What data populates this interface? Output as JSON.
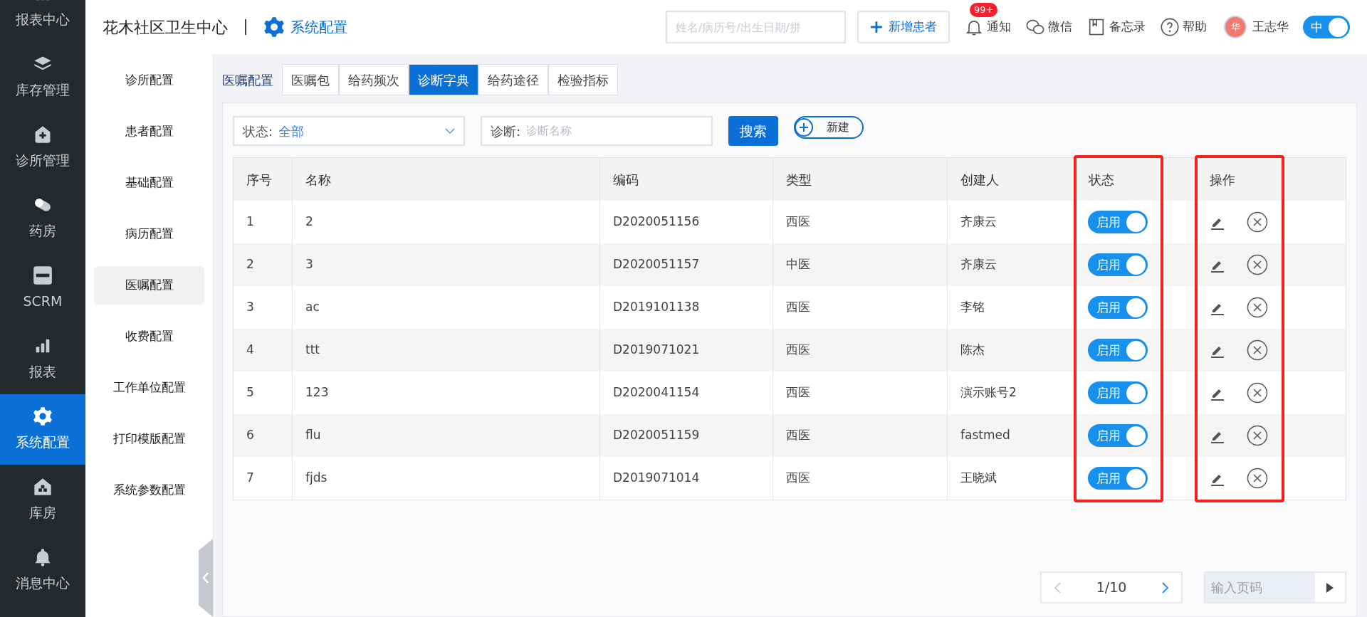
{
  "nav": {
    "items": [
      {
        "label": "报表中心",
        "kind": "chart",
        "selected": false
      },
      {
        "label": "库存管理",
        "kind": "layers",
        "selected": false
      },
      {
        "label": "诊所管理",
        "kind": "clinic",
        "selected": false
      },
      {
        "label": "药房",
        "kind": "pill",
        "selected": false
      },
      {
        "label": "SCRM",
        "kind": "scrm",
        "selected": false
      },
      {
        "label": "报表",
        "kind": "chart",
        "selected": false
      },
      {
        "label": "系统配置",
        "kind": "gear",
        "selected": true
      },
      {
        "label": "库房",
        "kind": "warehouse",
        "selected": false
      },
      {
        "label": "消息中心",
        "kind": "bell",
        "selected": false
      }
    ]
  },
  "header": {
    "clinic": "花木社区卫生中心",
    "section": "系统配置",
    "search": {
      "placeholder": "姓名/病历号/出生日期/拼"
    },
    "new_patient": "新增患者",
    "tools": [
      {
        "label": "通知",
        "kind": "bell",
        "badge": "99+"
      },
      {
        "label": "微信",
        "kind": "chat"
      },
      {
        "label": "备忘录",
        "kind": "book"
      },
      {
        "label": "帮助",
        "kind": "help"
      }
    ],
    "user": {
      "avatar": "华",
      "name": "王志华"
    },
    "lang_toggle": {
      "label": "中",
      "on": true
    }
  },
  "subnav": {
    "items": [
      {
        "label": "诊所配置",
        "selected": false
      },
      {
        "label": "患者配置",
        "selected": false
      },
      {
        "label": "基础配置",
        "selected": false
      },
      {
        "label": "病历配置",
        "selected": false
      },
      {
        "label": "医嘱配置",
        "selected": true
      },
      {
        "label": "收费配置",
        "selected": false
      },
      {
        "label": "工作单位配置",
        "selected": false
      },
      {
        "label": "打印模版配置",
        "selected": false
      },
      {
        "label": "系统参数配置",
        "selected": false
      }
    ]
  },
  "tabs": {
    "group_label": "医嘱配置",
    "items": [
      {
        "label": "医嘱包",
        "selected": false
      },
      {
        "label": "给药频次",
        "selected": false
      },
      {
        "label": "诊断字典",
        "selected": true
      },
      {
        "label": "给药途径",
        "selected": false
      },
      {
        "label": "检验指标",
        "selected": false
      }
    ]
  },
  "filters": {
    "status": {
      "label": "状态:",
      "value": "全部"
    },
    "diagnosis": {
      "label": "诊断:",
      "placeholder": "诊断名称"
    },
    "search_button": "搜索",
    "new_button": "新建"
  },
  "table": {
    "columns": [
      {
        "label": "序号",
        "highlighted": false
      },
      {
        "label": "名称",
        "highlighted": false
      },
      {
        "label": "编码",
        "highlighted": false
      },
      {
        "label": "类型",
        "highlighted": false
      },
      {
        "label": "创建人",
        "highlighted": false
      },
      {
        "label": "状态",
        "highlighted": true
      },
      {
        "label": "操作",
        "highlighted": true
      }
    ],
    "rows": [
      {
        "no": "1",
        "name": "2",
        "code": "D2020051156",
        "type": "西医",
        "creator": "齐康云",
        "status": {
          "label": "启用",
          "on": true
        }
      },
      {
        "no": "2",
        "name": "3",
        "code": "D2020051157",
        "type": "中医",
        "creator": "齐康云",
        "status": {
          "label": "启用",
          "on": true
        }
      },
      {
        "no": "3",
        "name": "ac",
        "code": "D2019101138",
        "type": "西医",
        "creator": "李铭",
        "status": {
          "label": "启用",
          "on": true
        }
      },
      {
        "no": "4",
        "name": "ttt",
        "code": "D2019071021",
        "type": "西医",
        "creator": "陈杰",
        "status": {
          "label": "启用",
          "on": true
        }
      },
      {
        "no": "5",
        "name": "123",
        "code": "D2020041154",
        "type": "西医",
        "creator": "演示账号2",
        "status": {
          "label": "启用",
          "on": true
        }
      },
      {
        "no": "6",
        "name": "flu",
        "code": "D2020051159",
        "type": "西医",
        "creator": "fastmed",
        "status": {
          "label": "启用",
          "on": true
        }
      },
      {
        "no": "7",
        "name": "fjds",
        "code": "D2019071014",
        "type": "西医",
        "creator": "王晓斌",
        "status": {
          "label": "启用",
          "on": true
        }
      }
    ]
  },
  "pagination": {
    "page": "1/10",
    "jump_placeholder": "输入页码"
  }
}
